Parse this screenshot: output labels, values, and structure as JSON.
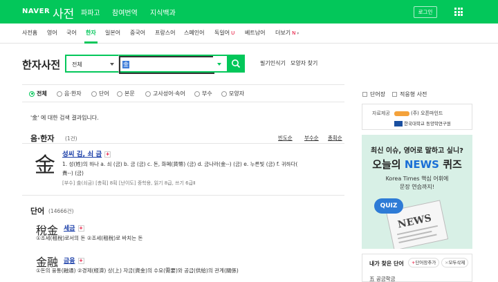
{
  "header": {
    "logo": "NAVER",
    "brand": "사전",
    "nav": [
      "파파고",
      "참여번역",
      "지식백과"
    ],
    "login": "로그인"
  },
  "langs": [
    {
      "label": "사전홈"
    },
    {
      "label": "영어"
    },
    {
      "label": "국어"
    },
    {
      "label": "한자"
    },
    {
      "label": "일본어"
    },
    {
      "label": "중국어"
    },
    {
      "label": "프랑스어"
    },
    {
      "label": "스페인어"
    },
    {
      "label": "독일어"
    },
    {
      "label": "베트남어"
    },
    {
      "label": "더보기"
    }
  ],
  "lang_badges": {
    "german": "U",
    "more": "N"
  },
  "page_title": "한자사전",
  "search": {
    "category": "전체",
    "query": "金",
    "tools": [
      "필기인식기",
      "모양자 찾기"
    ]
  },
  "filters": [
    "전체",
    "음·한자",
    "단어",
    "본문",
    "고사성어·속어",
    "부수",
    "모양자"
  ],
  "result_note": "'金' 에 대한 검색 결과입니다.",
  "section_hanja": {
    "title": "음·한자",
    "count": "(1건)",
    "sorts": [
      "빈도순",
      "부수순",
      "총획순"
    ],
    "char": "金",
    "reading": "성씨 김, 쇠 금",
    "def1": "1. 성(姓)의 하나 a. 쇠 (금) b. 금 (금) c. 돈, 화폐(貨幣) (금) d. 금나라(金--) (금) e. 누른빛 (금) f. 귀하다(",
    "def2": "貴--) (금)",
    "meta": "[부수] 金(쇠금) [총획] 8획 [난이도] 중학용, 읽기 8급, 쓰기 6급Ⅱ"
  },
  "section_words": {
    "title": "단어",
    "count": "(14666건)",
    "items": [
      {
        "hanja": "稅金",
        "reading": "세금",
        "def": "①조세(租稅)로서의 돈 ②조세(租稅)로 바치는 돈"
      },
      {
        "hanja": "金融",
        "reading": "금융",
        "def": "①돈의 융통(融通) ②경제(經濟) 상(上) 자금(資金)의 수요(需要)와 공급(供給)의 관계(關係)"
      }
    ]
  },
  "sidebar": {
    "checks": [
      "단어장",
      "적응형 사전"
    ],
    "sponsor_label": "자료제공",
    "sponsor1": "(주) 오픈마인드",
    "sponsor2": "한국대학교 동양학연구원",
    "ad": {
      "line1": "최신 이슈, 영어로 말하고 싶니?",
      "line2a": "오늘의 ",
      "line2b": "NEWS",
      "line2c": " 퀴즈",
      "line3": "Korea Times 핵심 어휘에",
      "line4": "문장 연습까지!",
      "quiz": "QUIZ",
      "news": "NEWS"
    },
    "recent": {
      "title": "내가 찾은 단어",
      "btn1": "단어장추가",
      "btn2": "모두삭제",
      "item": "五 공금학금"
    }
  },
  "colors": {
    "accent": "#03c75a",
    "link": "#1a3ea8",
    "badge": "#e5002b"
  }
}
